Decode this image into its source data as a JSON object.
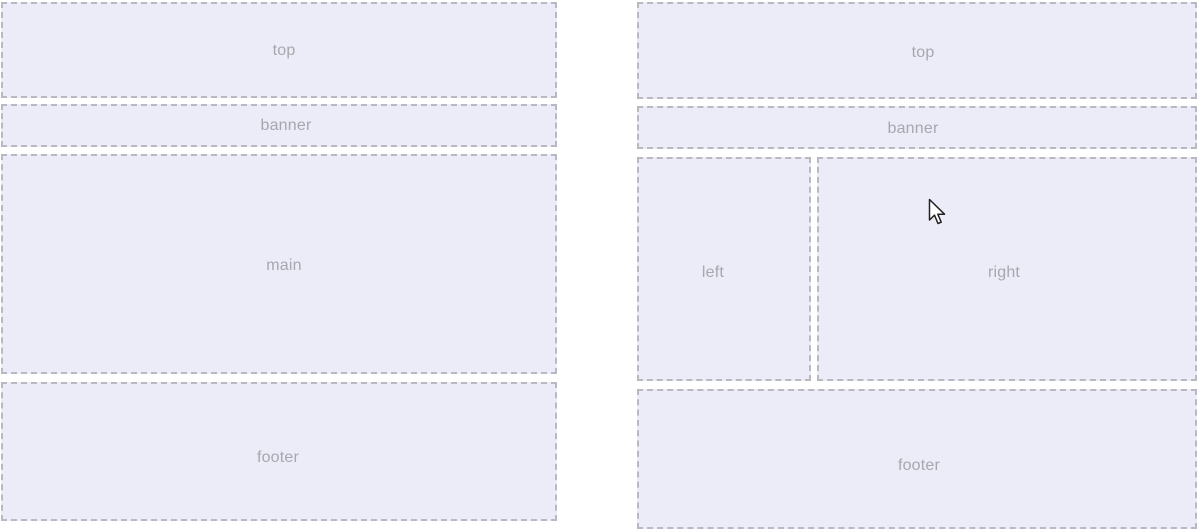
{
  "left_layout": {
    "top": "top",
    "banner": "banner",
    "main": "main",
    "footer": "footer"
  },
  "right_layout": {
    "top": "top",
    "banner": "banner",
    "left": "left",
    "right": "right",
    "footer": "footer"
  },
  "colors": {
    "box_background": "#ecebf8",
    "box_border": "#b9b9c2",
    "label_text": "#a7a7ad"
  },
  "icons": {
    "cursor": "mouse-pointer-icon"
  }
}
